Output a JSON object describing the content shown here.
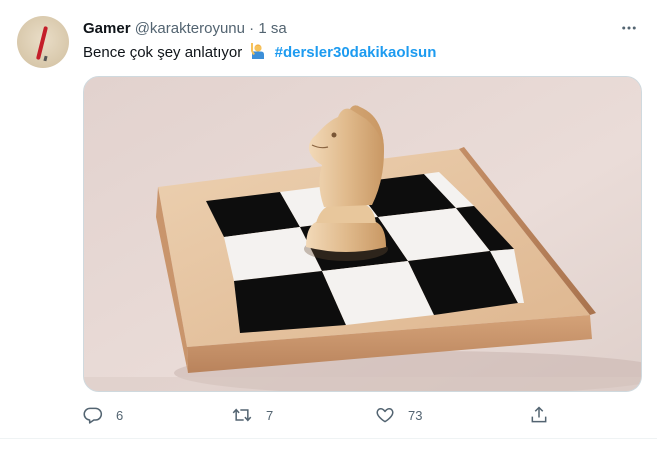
{
  "tweet": {
    "display_name": "Gamer",
    "handle": "@karakteroyunu",
    "separator": "·",
    "time": "1 sa",
    "text": "Bence çok şey anlatıyor",
    "hashtag": "#dersler30dakikaolsun",
    "emoji": "person-raising-hand-icon"
  },
  "media": {
    "subject": "chess-knight-on-board-photo",
    "colors": {
      "wood_light": "#e3c3a1",
      "wood_dark": "#c8936a",
      "square_black": "#0d0d0d",
      "square_white": "#f4f2f0",
      "wall": "#e8dad6"
    }
  },
  "actions": {
    "reply_count": "6",
    "retweet_count": "7",
    "like_count": "73"
  },
  "colors": {
    "accent": "#1d9bf0",
    "muted": "#536471",
    "text": "#0f1419"
  }
}
